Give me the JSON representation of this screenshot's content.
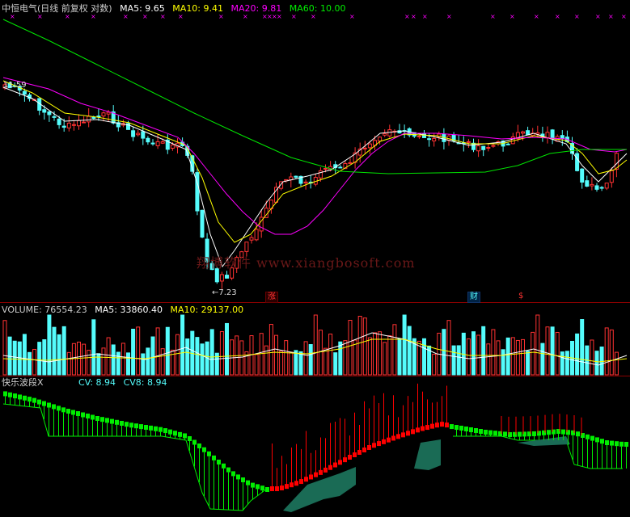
{
  "price_header": {
    "title": "中恒电气(日线 前复权 对数)",
    "ma5": "MA5: 9.65",
    "ma10": "MA10: 9.41",
    "ma20": "MA20: 9.81",
    "ma60": "MA60: 10.00"
  },
  "volume_header": {
    "volume": "VOLUME: 76554.23",
    "ma5": "MA5: 33860.40",
    "ma10": "MA10: 29137.00"
  },
  "indicator_header": {
    "name": "快乐波段X",
    "cv": "CV: 8.94",
    "cv8": "CV8: 8.94"
  },
  "annotations": {
    "high_label": "11.59",
    "low_label": "←7.23",
    "badge_zhang": "涨",
    "badge_cai": "财",
    "badge_dollar": "$",
    "watermark": "翔博软件 www.xiangbosoft.com"
  },
  "colors": {
    "up": "#ff3232",
    "down": "#54fcfc",
    "ma5": "#ffffff",
    "ma10": "#ffff00",
    "ma20": "#ff00ff",
    "ma60": "#00e600",
    "title": "#cccccc",
    "grid": "#8b0000",
    "green_bar": "#00ee00",
    "red_bar": "#ff0000",
    "band": "#1a6b55",
    "marker": "#ff00ff"
  }
}
